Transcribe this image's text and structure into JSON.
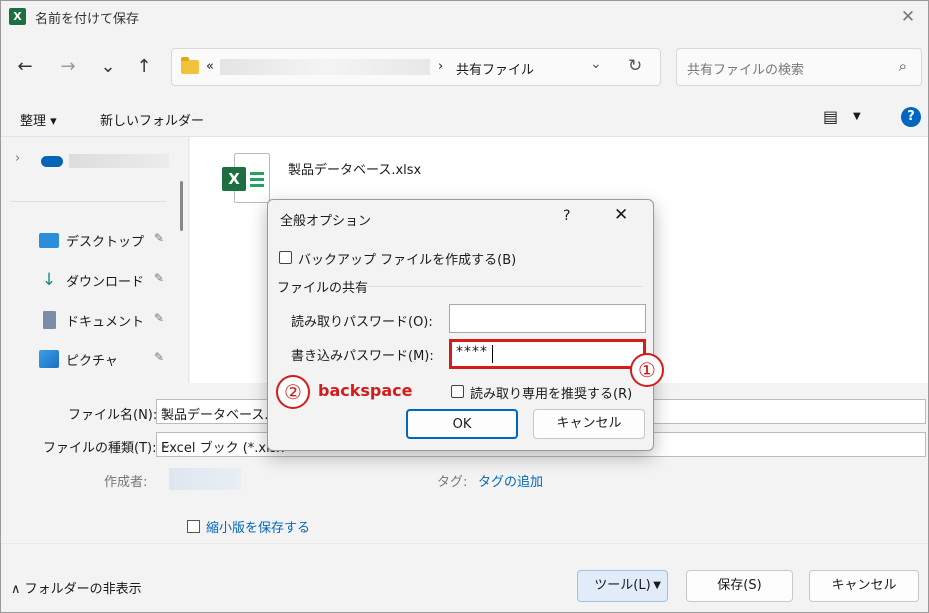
{
  "window": {
    "title": "名前を付けて保存",
    "app_icon": "X"
  },
  "nav": {
    "back_icon": "←",
    "forward_icon": "→",
    "recent_icon": "⌄",
    "up_icon": "↑",
    "address_prefix": "«",
    "address_sep": "›",
    "address_current": "共有ファイル",
    "dropdown_icon": "⌄",
    "refresh_icon": "↻",
    "search_placeholder": "共有ファイルの検索",
    "search_icon": "⌕"
  },
  "toolbar": {
    "organize": "整理 ▾",
    "new_folder": "新しいフォルダー",
    "view_icon": "▤",
    "view_drop": "▼",
    "help": "?"
  },
  "sidebar": {
    "expand_icon": "›",
    "items": [
      {
        "label": "デスクトップ",
        "icon": "desktop-icon"
      },
      {
        "label": "ダウンロード",
        "icon": "download-icon"
      },
      {
        "label": "ドキュメント",
        "icon": "document-icon"
      },
      {
        "label": "ピクチャ",
        "icon": "picture-icon"
      }
    ],
    "pin_icon": "📌"
  },
  "files": [
    {
      "name": "製品データベース.xlsx",
      "badge": "X"
    }
  ],
  "form": {
    "filename_label": "ファイル名(N):",
    "filename_value": "製品データベース.xl",
    "filetype_label": "ファイルの種類(T):",
    "filetype_value": "Excel ブック (*.xlsx",
    "author_label": "作成者:",
    "tag_label": "タグ:",
    "tag_link": "タグの追加",
    "thumbnail_label": "縮小版を保存する"
  },
  "footer": {
    "hide_folders": "∧ フォルダーの非表示",
    "tools": "ツール(L)",
    "tools_drop": "▼",
    "save": "保存(S)",
    "cancel": "キャンセル"
  },
  "dialog": {
    "title": "全般オプション",
    "help": "?",
    "close": "✕",
    "backup_label": "バックアップ ファイルを作成する(B)",
    "share_heading": "ファイルの共有",
    "open_pw_label": "読み取りパスワード(O):",
    "open_pw_value": "",
    "modify_pw_label": "書き込みパスワード(M):",
    "modify_pw_value": "****",
    "readonly_label": "読み取り専用を推奨する(R)",
    "ok": "OK",
    "cancel": "キャンセル"
  },
  "annotations": {
    "step1": "①",
    "step2": "②",
    "step2_text": "backspace"
  },
  "colors": {
    "accent": "#0067c0",
    "annotation": "#d41c1c",
    "excel": "#1d6f42"
  }
}
